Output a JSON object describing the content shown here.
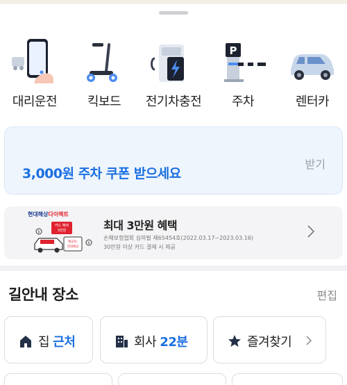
{
  "services": [
    {
      "label": "대리운전",
      "icon": "phone-driver-icon"
    },
    {
      "label": "킥보드",
      "icon": "kickboard-icon"
    },
    {
      "label": "전기차충전",
      "icon": "ev-charger-icon"
    },
    {
      "label": "주차",
      "icon": "parking-gate-icon"
    },
    {
      "label": "렌터카",
      "icon": "rental-car-icon"
    }
  ],
  "coupon": {
    "text": "3,000원 주차 쿠폰 받으세요",
    "button": "받기"
  },
  "ad": {
    "brand_a": "현대해상",
    "brand_b": "다이렉트",
    "badge1": "카드 혜택",
    "badge2": "3만원",
    "badge3": "제공처:",
    "badge4": "현대해상",
    "title": "최대 3만원 혜택",
    "line1": "손해보험협회 심의필 제65454호(2022.03.17~2023.03.16)",
    "line2": "30만원 이상 카드 결제 시 제공"
  },
  "places": {
    "title": "길안내 장소",
    "edit": "편집",
    "home_label": "집",
    "home_value": "근처",
    "work_label": "회사",
    "work_value": "22분",
    "fav_label": "즐겨찾기"
  },
  "colors": {
    "accent": "#1a6fe0",
    "coupon_bg": "#eef5fd"
  }
}
